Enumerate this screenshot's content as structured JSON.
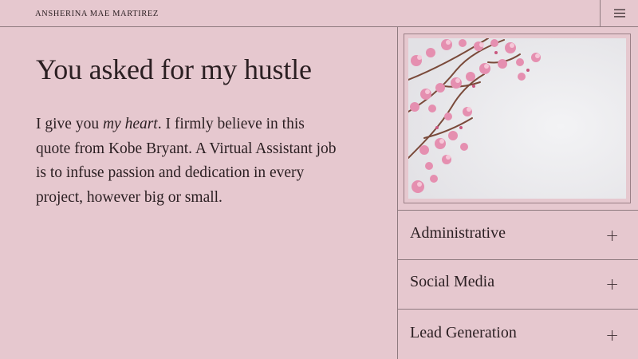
{
  "header": {
    "brand": "ANSHERINA MAE MARTIREZ",
    "menu_icon": "hamburger-menu-icon"
  },
  "hero": {
    "title": "You asked for my hustle",
    "intro_prefix": "I give you ",
    "intro_emphasis": "my heart",
    "intro_suffix": ". I firmly believe in this quote from Kobe Bryant. A Virtual Assistant job is to infuse passion and dedication in every project, however big or small."
  },
  "accordion": [
    {
      "label": "Administrative",
      "icon": "plus-icon",
      "symbol": "+"
    },
    {
      "label": "Social Media",
      "icon": "plus-icon",
      "symbol": "+"
    },
    {
      "label": "Lead Generation",
      "icon": "plus-icon",
      "symbol": "+"
    }
  ],
  "colors": {
    "background": "#e6c8cf",
    "text": "#2b1f22",
    "lines": "#8e7a7f"
  }
}
